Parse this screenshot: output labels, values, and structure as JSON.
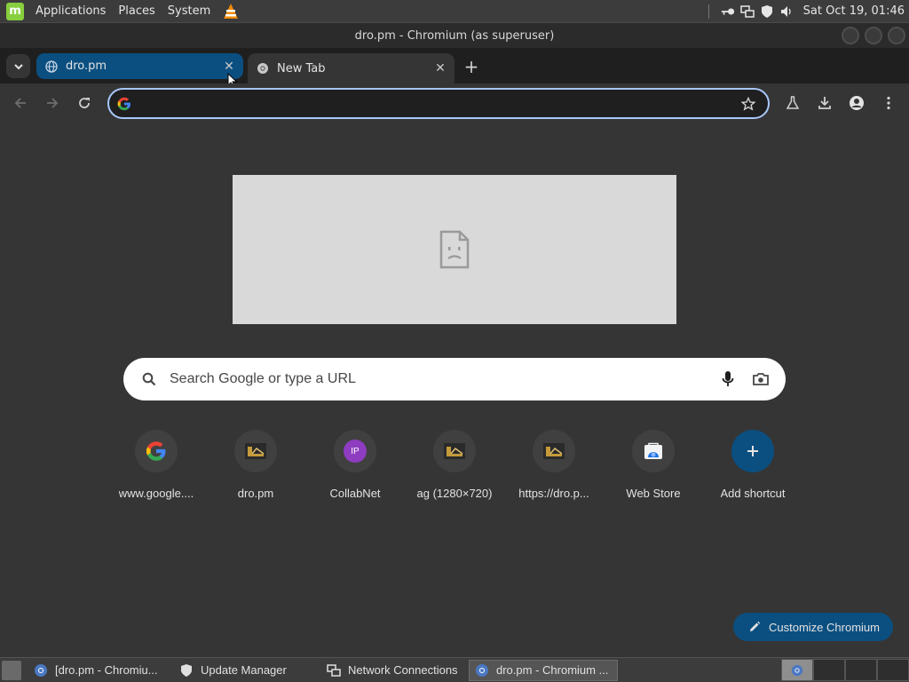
{
  "system_panel": {
    "menus": [
      "Applications",
      "Places",
      "System"
    ],
    "clock": "Sat Oct 19, 01:46"
  },
  "window": {
    "title": "dro.pm - Chromium (as superuser)"
  },
  "tabs": [
    {
      "title": "dro.pm",
      "favicon": "globe-icon"
    },
    {
      "title": "New Tab",
      "favicon": "chromium-icon"
    }
  ],
  "omnibox": {
    "value": "",
    "placeholder": ""
  },
  "ntp": {
    "search_placeholder": "Search Google or type a URL",
    "shortcuts": [
      {
        "label": "www.google....",
        "icon": "google-icon"
      },
      {
        "label": "dro.pm",
        "icon": "dro-favicon-icon"
      },
      {
        "label": "CollabNet",
        "icon": "ip-badge-icon",
        "badge": "IP"
      },
      {
        "label": "ag (1280×720)",
        "icon": "dro-favicon-icon"
      },
      {
        "label": "https://dro.p...",
        "icon": "dro-favicon-icon"
      },
      {
        "label": "Web Store",
        "icon": "web-store-icon"
      },
      {
        "label": "Add shortcut",
        "icon": "plus-icon"
      }
    ],
    "customize_label": "Customize Chromium"
  },
  "taskbar": {
    "tasks": [
      {
        "label": "[dro.pm - Chromiu...",
        "icon": "chromium-icon",
        "active": false
      },
      {
        "label": "Update Manager",
        "icon": "shield-icon",
        "active": false
      },
      {
        "label": "Network Connections",
        "icon": "network-icon",
        "active": false
      },
      {
        "label": "dro.pm - Chromium ...",
        "icon": "chromium-icon",
        "active": true
      }
    ]
  },
  "colors": {
    "accent_blue": "#0b4f80",
    "omnibox_focus": "#a8c7fa",
    "background": "#353535"
  }
}
